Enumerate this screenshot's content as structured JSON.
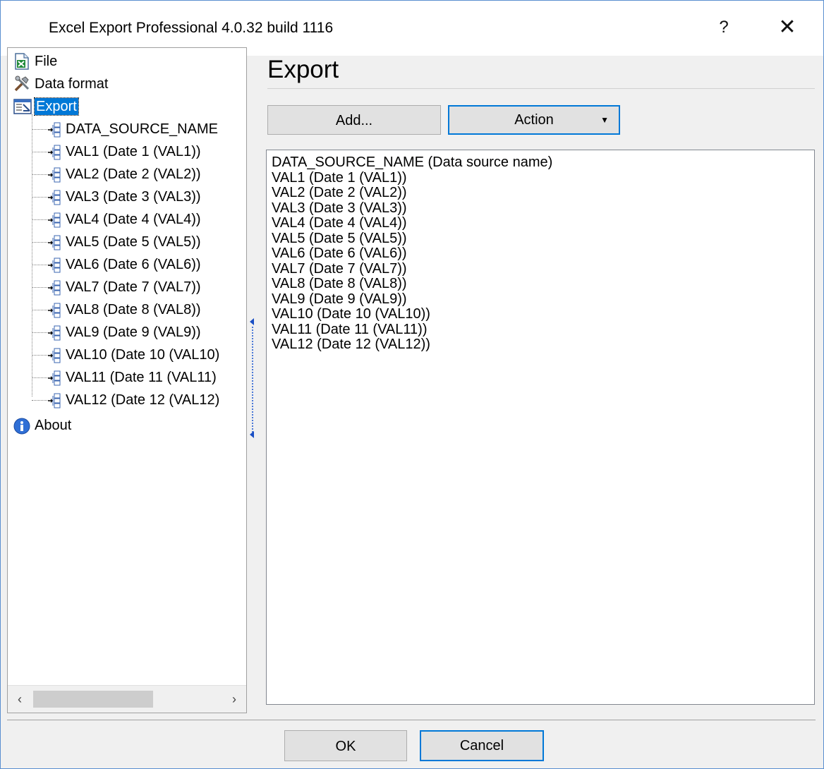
{
  "window": {
    "title": "Excel Export Professional 4.0.32 build 1116",
    "help_glyph": "?",
    "close_glyph": "✕"
  },
  "tree": {
    "top_items": [
      {
        "label": "File",
        "icon": "excel-file-icon"
      },
      {
        "label": "Data format",
        "icon": "tools-icon"
      },
      {
        "label": "Export",
        "icon": "export-icon",
        "selected": true
      }
    ],
    "children": [
      "DATA_SOURCE_NAME",
      "VAL1 (Date 1 (VAL1))",
      "VAL2 (Date 2 (VAL2))",
      "VAL3 (Date 3 (VAL3))",
      "VAL4 (Date 4 (VAL4))",
      "VAL5 (Date 5 (VAL5))",
      "VAL6 (Date 6 (VAL6))",
      "VAL7 (Date 7 (VAL7))",
      "VAL8 (Date 8 (VAL8))",
      "VAL9 (Date 9 (VAL9))",
      "VAL10 (Date 10 (VAL10)",
      "VAL11 (Date 11 (VAL11)",
      "VAL12 (Date 12 (VAL12)"
    ],
    "about": {
      "label": "About",
      "icon": "info-icon"
    }
  },
  "scrollbar": {
    "left_glyph": "‹",
    "right_glyph": "›"
  },
  "main": {
    "title": "Export",
    "add_label": "Add...",
    "action_label": "Action",
    "action_dropdown_glyph": "▼",
    "list_items": [
      "DATA_SOURCE_NAME (Data source name)",
      "VAL1 (Date 1 (VAL1))",
      "VAL2 (Date 2 (VAL2))",
      "VAL3 (Date 3 (VAL3))",
      "VAL4 (Date 4 (VAL4))",
      "VAL5 (Date 5 (VAL5))",
      "VAL6 (Date 6 (VAL6))",
      "VAL7 (Date 7 (VAL7))",
      "VAL8 (Date 8 (VAL8))",
      "VAL9 (Date 9 (VAL9))",
      "VAL10 (Date 10 (VAL10))",
      "VAL11 (Date 11 (VAL11))",
      "VAL12 (Date 12 (VAL12))"
    ]
  },
  "footer": {
    "ok_label": "OK",
    "cancel_label": "Cancel"
  },
  "colors": {
    "accent": "#0078d7",
    "selection": "#0078d7"
  }
}
